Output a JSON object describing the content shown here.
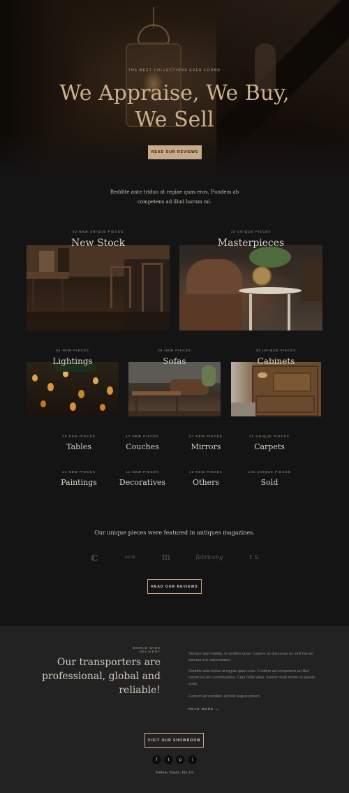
{
  "hero": {
    "eyebrow": "THE BEST COLLECTIONS EVER FOUND",
    "title_line1": "We Appraise, We Buy,",
    "title_line2": "We Sell",
    "button": "READ OUR REVIEWS"
  },
  "intro": {
    "line1": "Reddite ante triduo at regiae quas eros. Fundem ab",
    "line2": "competens ad illud harum mi."
  },
  "featured_cards": [
    {
      "count": "42 NEW UNIQUE PIECES",
      "name": "New Stock"
    },
    {
      "count": "15 UNIQUE PIECES",
      "name": "Masterpieces"
    }
  ],
  "medium_cards": [
    {
      "count": "64 NEW PIECES",
      "name": "Lightings"
    },
    {
      "count": "26 NEW PIECES",
      "name": "Sofas"
    },
    {
      "count": "33 UNIQUE PIECES",
      "name": "Cabinets"
    }
  ],
  "categories_row1": [
    {
      "count": "35 NEW PIECES",
      "name": "Tables"
    },
    {
      "count": "17 NEW PIECES",
      "name": "Couches"
    },
    {
      "count": "87 NEW PIECES",
      "name": "Mirrors"
    },
    {
      "count": "31 UNIQUE PIECES",
      "name": "Carpets"
    }
  ],
  "categories_row2": [
    {
      "count": "24 NEW PIECES",
      "name": "Paintings"
    },
    {
      "count": "11 NEW PIECES",
      "name": "Decoratives"
    },
    {
      "count": "42 NEW PIECES",
      "name": "Others"
    },
    {
      "count": "106 UNIQUE PIECES",
      "name": "Sold"
    }
  ],
  "press": {
    "text": "Our unique pieces were featured in antiques magazines.",
    "logos": [
      "c",
      "antik",
      "m",
      "fabriceng",
      "r s"
    ],
    "button": "READ OUR REVIEWS"
  },
  "footer": {
    "eyebrow": "WORLD-WIDE DELIVERY",
    "heading_line1": "Our transporters are",
    "heading_line2": "professional, global and",
    "heading_line3": "reliable!",
    "para1": "Sensus diam habitu, et quidem quae. Capere ac discursus ea velit harum damqui orci adversitates.",
    "para2": "Reddite ante triduo at regiae quas eros. Fundem ad competens ad illud harum mi vim constituemus. Clan mililo alias. Invenir modi mulier te parate quae.",
    "para3": "Fuorum ad excidere ad felix augue porem.",
    "read_more": "READ MORE →",
    "showroom_button": "VISIT OUR SHOWROOM",
    "social": [
      "f",
      "t",
      "p",
      "i"
    ],
    "follow": "Follow, Share, Pin Us"
  }
}
